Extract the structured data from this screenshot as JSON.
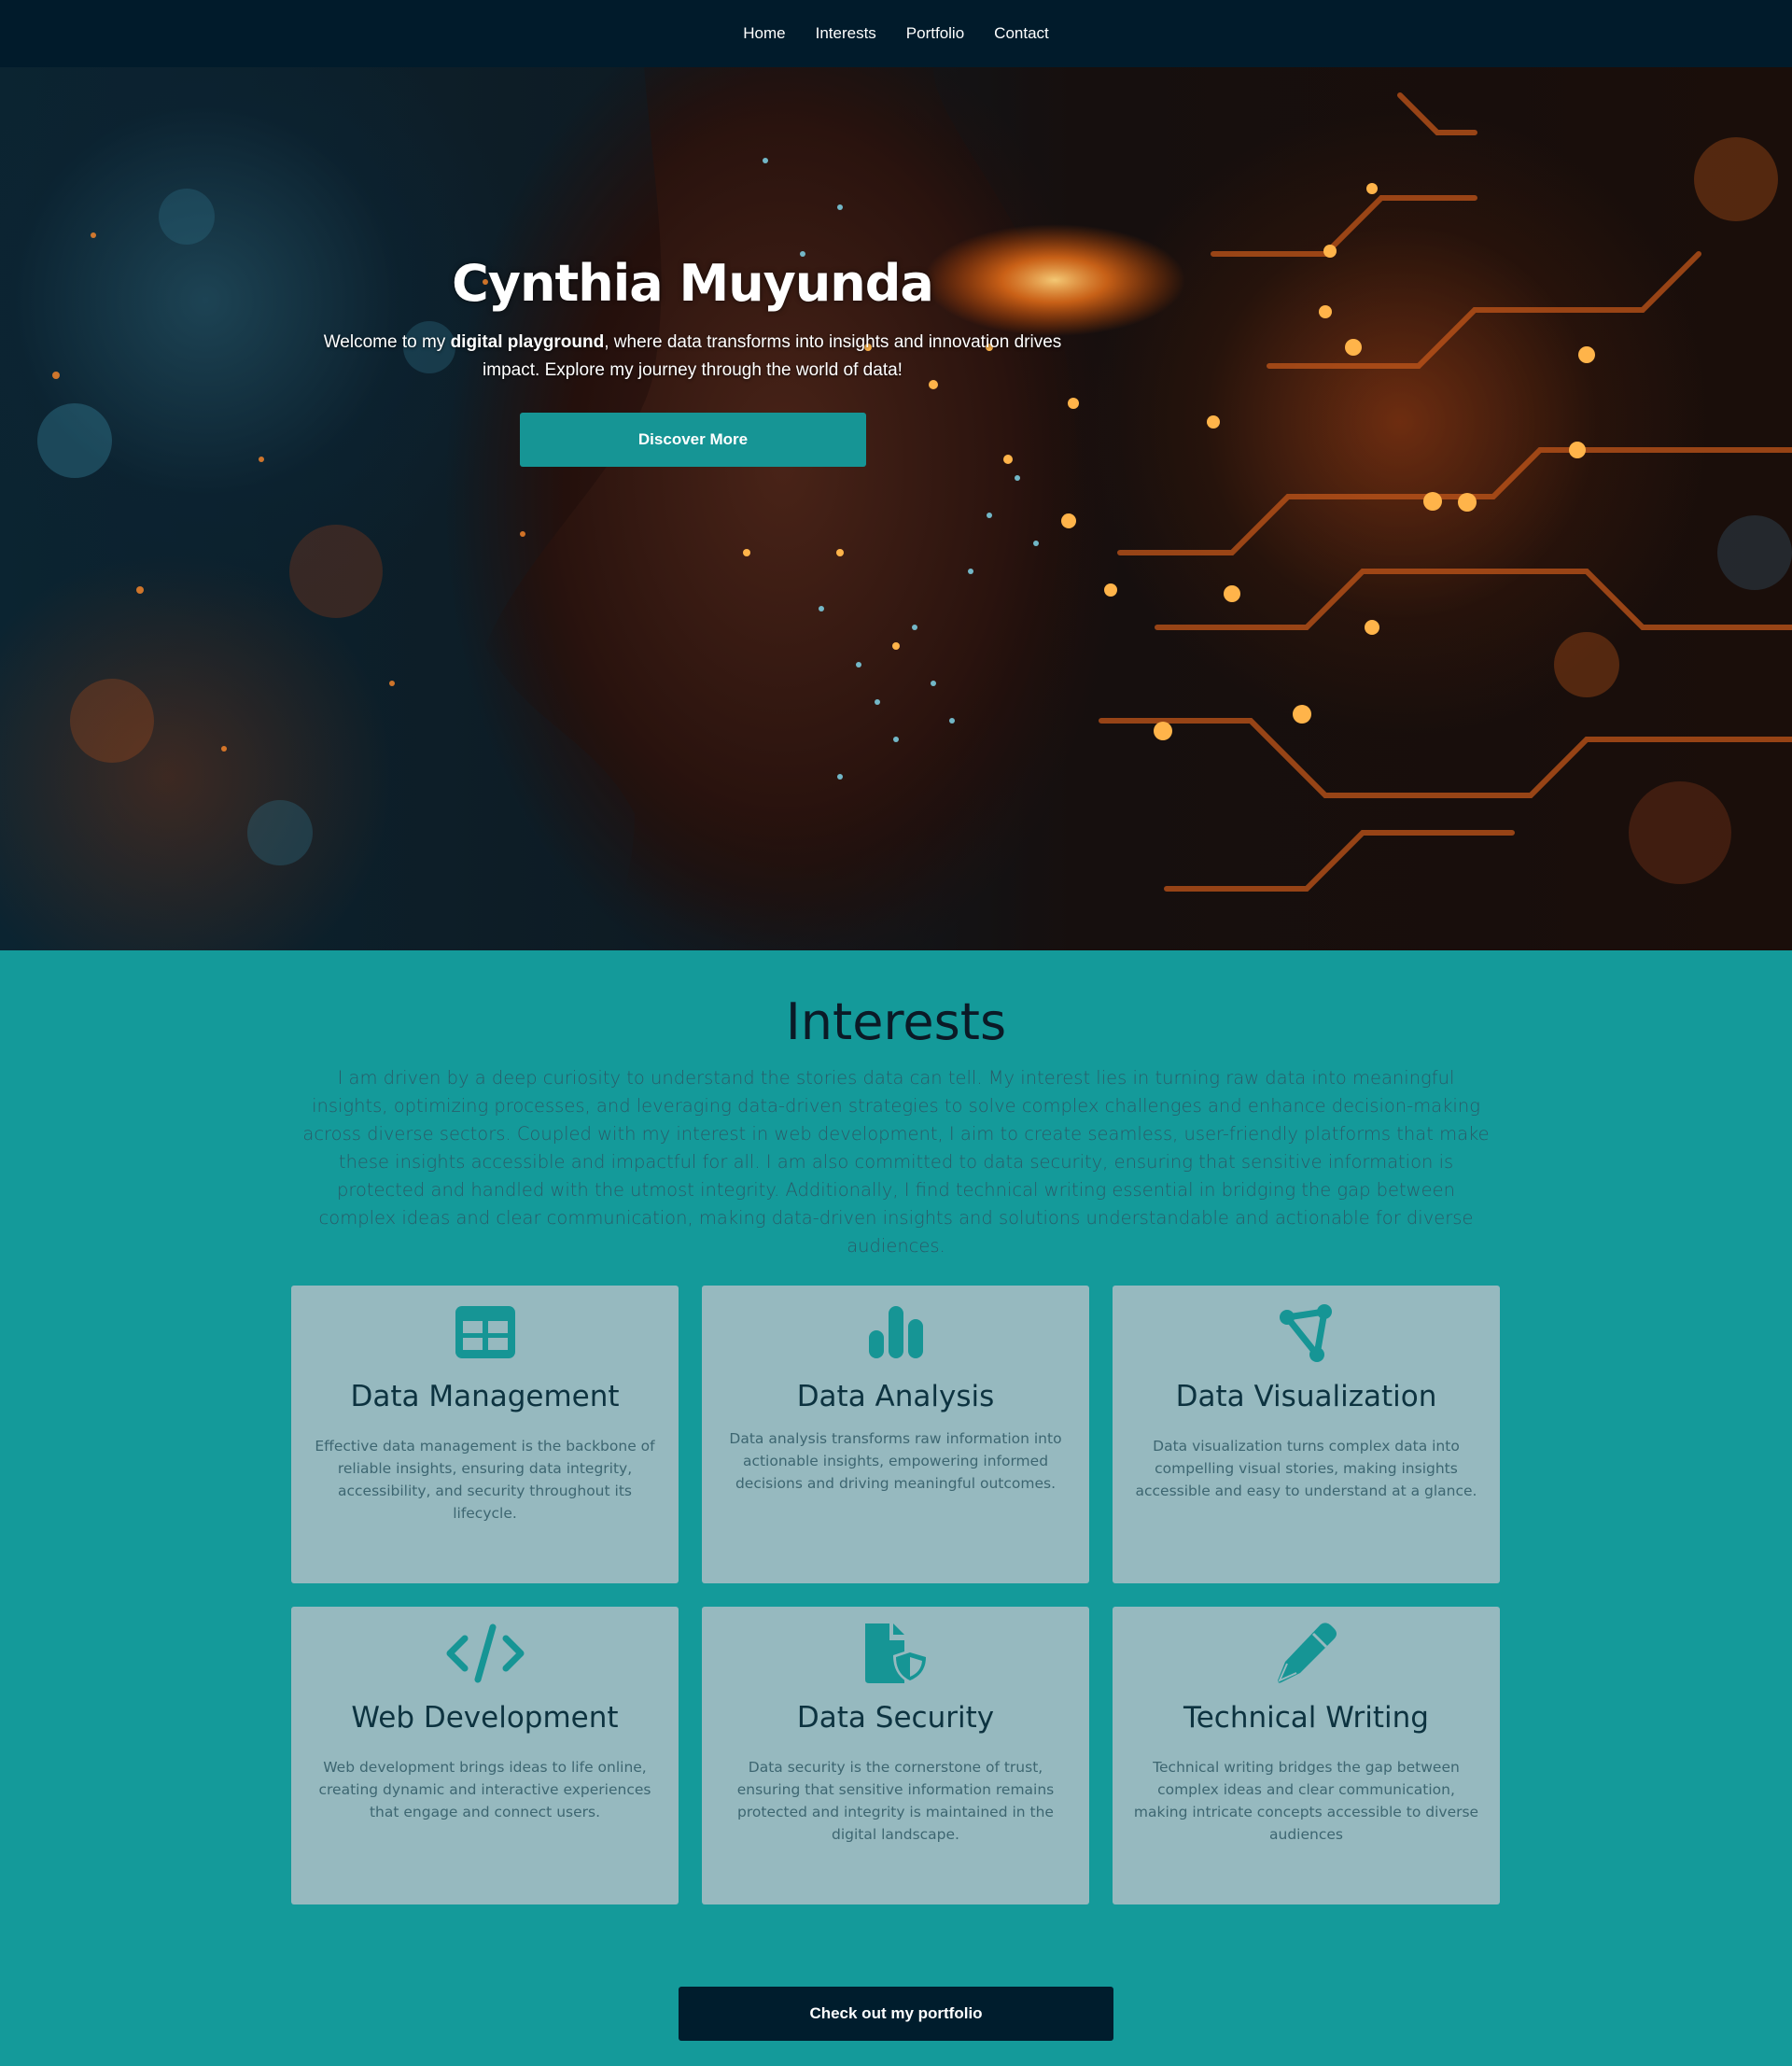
{
  "nav": {
    "items": [
      {
        "label": "Home"
      },
      {
        "label": "Interests"
      },
      {
        "label": "Portfolio"
      },
      {
        "label": "Contact"
      }
    ]
  },
  "hero": {
    "title": "Cynthia Muyunda",
    "subtitle_pre": "Welcome to my ",
    "subtitle_bold": "digital playground",
    "subtitle_post": ", where data transforms into insights and innovation drives impact. Explore my journey through the world of data!",
    "button_label": "Discover More"
  },
  "interests": {
    "title": "Interests",
    "description": "I am driven by a deep curiosity to understand the stories data can tell. My interest lies in turning raw data into meaningful insights, optimizing processes, and leveraging data-driven strategies to solve complex challenges and enhance decision-making across diverse sectors. Coupled with my interest in web development, I aim to create seamless, user-friendly platforms that make these insights accessible and impactful for all. I am also committed to data security, ensuring that sensitive information is protected and handled with the utmost integrity. Additionally, I find technical writing essential in bridging the gap between complex ideas and clear communication, making data-driven insights and solutions understandable and actionable for diverse audiences.",
    "cards": [
      {
        "icon": "table-icon",
        "title": "Data Management",
        "text": "Effective data management is the backbone of reliable insights, ensuring data integrity, accessibility, and security throughout its lifecycle."
      },
      {
        "icon": "bar-chart-icon",
        "title": "Data Analysis",
        "text": "Data analysis transforms raw information into actionable insights, empowering informed decisions and driving meaningful outcomes."
      },
      {
        "icon": "vector-nodes-icon",
        "title": "Data Visualization",
        "text": "Data visualization turns complex data into compelling visual stories, making insights accessible and easy to understand at a glance."
      },
      {
        "icon": "code-icon",
        "title": "Web Development",
        "text": "Web development brings ideas to life online, creating dynamic and interactive experiences that engage and connect users."
      },
      {
        "icon": "file-shield-icon",
        "title": "Data Security",
        "text": "Data security is the cornerstone of trust, ensuring that sensitive information remains protected and integrity is maintained in the digital landscape."
      },
      {
        "icon": "pen-icon",
        "title": "Technical Writing",
        "text": "Technical writing bridges the gap between complex ideas and clear communication, making intricate concepts accessible to diverse audiences"
      }
    ],
    "icon_color": "#169595",
    "card_color": "#96b9bf"
  },
  "portfolio_button": {
    "label": "Check out my portfolio"
  }
}
